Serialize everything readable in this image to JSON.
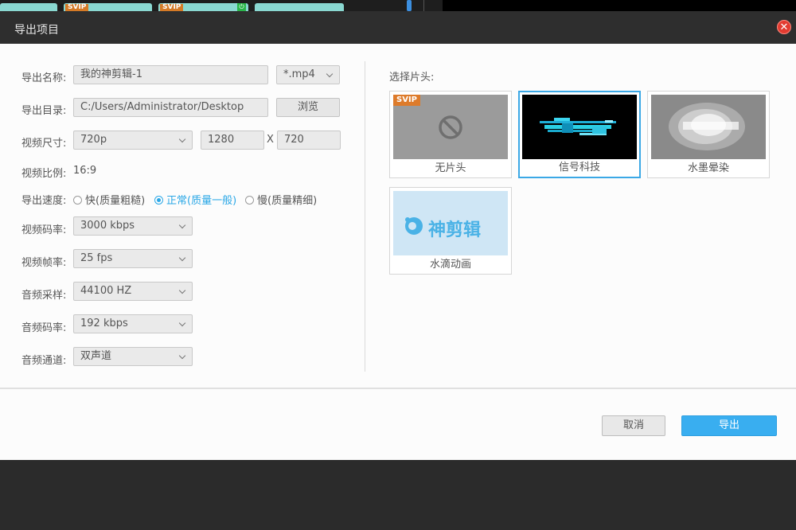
{
  "background": {
    "vip_tags": [
      "SVIP",
      "SVIP"
    ]
  },
  "dialog": {
    "title": "导出项目",
    "close_icon": "close-icon"
  },
  "form": {
    "name_label": "导出名称:",
    "name_value": "我的神剪辑-1",
    "format_value": "*.mp4",
    "dir_label": "导出目录:",
    "dir_value": "C:/Users/Administrator/Desktop",
    "browse_label": "浏览",
    "size_label": "视频尺寸:",
    "size_value": "720p",
    "width_value": "1280",
    "x_sep": "X",
    "height_value": "720",
    "ratio_label": "视频比例:",
    "ratio_value": "16:9",
    "speed_label": "导出速度:",
    "speed_options": [
      "快(质量粗糙)",
      "正常(质量一般)",
      "慢(质量精细)"
    ],
    "speed_selected": "正常(质量一般)",
    "bitrate_label": "视频码率:",
    "bitrate_value": "3000 kbps",
    "fps_label": "视频帧率:",
    "fps_value": "25 fps",
    "samplerate_label": "音频采样:",
    "samplerate_value": "44100 HZ",
    "audio_bitrate_label": "音频码率:",
    "audio_bitrate_value": "192 kbps",
    "channel_label": "音频通道:",
    "channel_value": "双声道"
  },
  "intro": {
    "label": "选择片头:",
    "badge": "SVIP",
    "items": [
      {
        "caption": "无片头",
        "icon": "no-entry-icon"
      },
      {
        "caption": "信号科技"
      },
      {
        "caption": "水墨晕染"
      },
      {
        "caption": "水滴动画",
        "logo_text": "神剪辑"
      }
    ],
    "selected": "信号科技"
  },
  "footer": {
    "cancel_label": "取消",
    "export_label": "导出"
  },
  "colors": {
    "accent": "#39aef0",
    "title_bar": "#2e2e2e",
    "close": "#e23b30"
  }
}
